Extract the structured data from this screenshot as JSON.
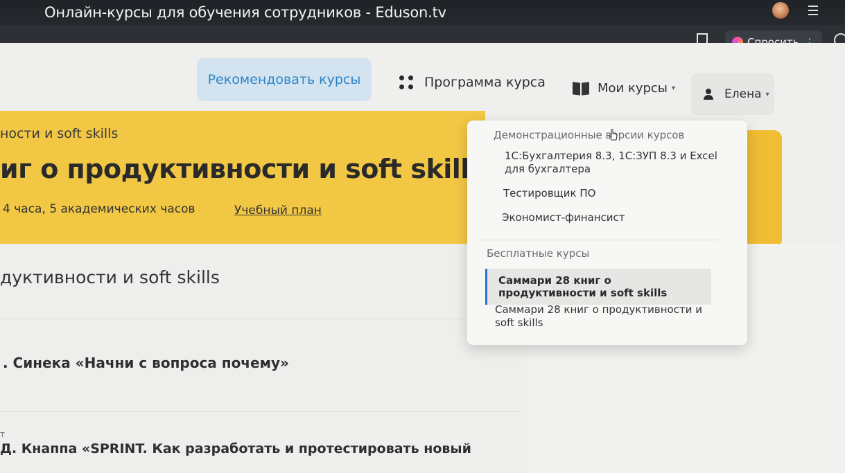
{
  "browser": {
    "window_title": "Онлайн-курсы для обучения сотрудников - Eduson.tv",
    "ask_button": "Спросить",
    "ask_menu": "⋮"
  },
  "nav": {
    "recommend": "Рекомендовать курсы",
    "program": "Программа курса",
    "my_courses": "Мои курсы",
    "user": "Елена",
    "caret": "▾"
  },
  "banner": {
    "crumb": "ности и soft skills",
    "headline": "иг о продуктивности и soft skills",
    "duration": "4 часа, 5 академических часов",
    "plan_link": "Учебный план"
  },
  "content": {
    "section_title": "дуктивности и soft skills",
    "item1": ". Синека «Начни с вопроса почему»",
    "item2_small": "т",
    "item2": "Д. Кнаппа «SPRINT. Как разработать и протестировать новый"
  },
  "dropdown": {
    "group1_label": "Демонстрационные версии курсов",
    "group1_items": [
      "1С:Бухгалтерия 8.3, 1С:ЗУП 8.3 и Excel для бухгалтера",
      "Тестировщик ПО",
      "Экономист-финансист"
    ],
    "group2_label": "Бесплатные курсы",
    "group2_items": [
      "Саммари 28 книг о продуктивности и soft skills",
      "Саммари 28 книг о продуктивности и soft skills"
    ]
  },
  "colors": {
    "banner": "#f2c744",
    "recommend_bg": "#d3e3ef",
    "recommend_text": "#2a86c9",
    "active_marker": "#2a6fd1"
  }
}
